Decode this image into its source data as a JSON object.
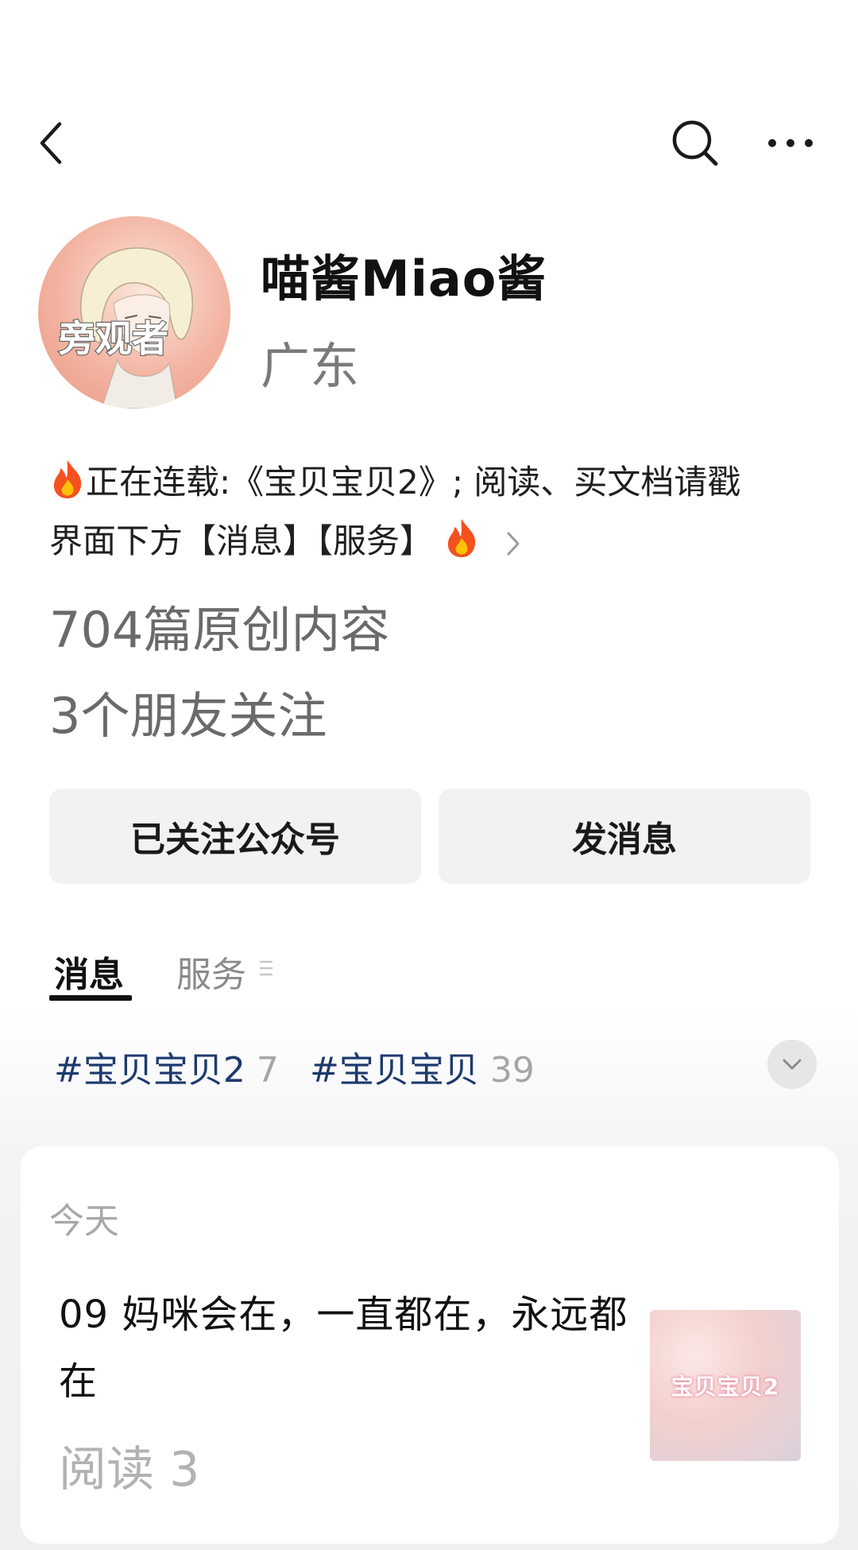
{
  "header": {
    "back_icon": "back-arrow-icon",
    "search_icon": "search-icon",
    "more_icon": "more-icon"
  },
  "profile": {
    "avatar_text": "旁观者",
    "name": "喵酱Miao酱",
    "region": "广东",
    "bio_line1": "正在连载:《宝贝宝贝2》; 阅读、买文档请戳",
    "bio_line2": "界面下方【消息】【服务】",
    "original_posts": "704篇原创内容",
    "friends_following": "3个朋友关注"
  },
  "actions": {
    "follow_label": "已关注公众号",
    "message_label": "发消息"
  },
  "tabs": [
    {
      "label": "消息",
      "active": true
    },
    {
      "label": "服务",
      "active": false
    }
  ],
  "tags": [
    {
      "label": "#宝贝宝贝2",
      "count": "7"
    },
    {
      "label": "#宝贝宝贝",
      "count": "39"
    }
  ],
  "feed": {
    "date": "今天",
    "article": {
      "title": "09 妈咪会在，一直都在，永远都在",
      "reads": "阅读 3",
      "thumbnail_text": "宝贝宝贝2"
    }
  },
  "colors": {
    "tag_blue": "#1c3a6e",
    "button_bg": "#f2f2f2",
    "muted_text": "#7a7a7a"
  }
}
